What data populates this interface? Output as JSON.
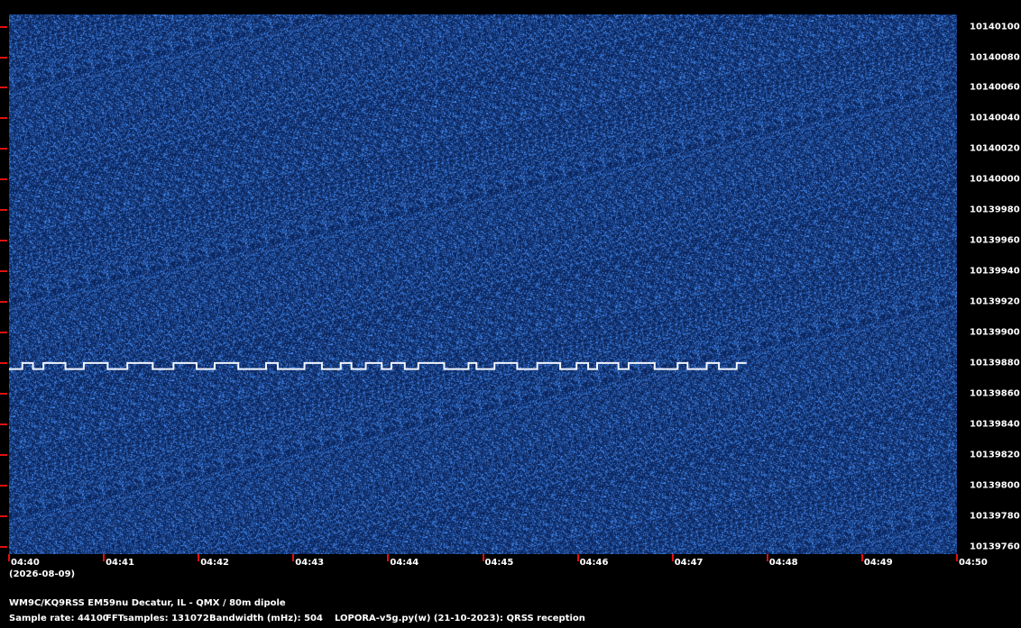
{
  "chart_data": {
    "type": "heatmap",
    "description_kind": "spectrogram",
    "y_unit": "Hz",
    "y_ticks": [
      10140100,
      10140080,
      10140060,
      10140040,
      10140020,
      10140000,
      10139980,
      10139960,
      10139940,
      10139920,
      10139900,
      10139880,
      10139860,
      10139840,
      10139820,
      10139800,
      10139780,
      10139760
    ],
    "y_labels": [
      "10140100",
      "10140080",
      "10140060",
      "10140040",
      "10140020",
      "10140000",
      "10139980",
      "10139960",
      "10139940",
      "10139920",
      "10139900",
      "10139880",
      "10139860",
      "10139840",
      "10139820",
      "10139800",
      "10139780",
      "10139760"
    ],
    "ylim": [
      10139755,
      10140108
    ],
    "x_labels": [
      "04:40",
      "04:41",
      "04:42",
      "04:43",
      "04:44",
      "04:45",
      "04:46",
      "04:47",
      "04:48",
      "04:49",
      "04:50"
    ],
    "x_minutes": [
      0,
      1,
      2,
      3,
      4,
      5,
      6,
      7,
      8,
      9,
      10
    ],
    "xlim": [
      0,
      10
    ],
    "date_label": "(2026-08-09)",
    "signal_trace": {
      "start_minute": 0.0,
      "end_minute": 7.78,
      "base_freq": 10139876,
      "shift_freq": 10139880
    },
    "colors": {
      "background": "#0b2a66",
      "signal": "#f2f6ff",
      "tick": "#e01010"
    }
  },
  "footer": {
    "station": "WM9C/KQ9RSS EM59nu Decatur, IL - QMX / 80m dipole",
    "sample_rate": "Sample rate: 44100",
    "fft_samples": "FFTsamples: 131072",
    "bandwidth": "Bandwidth (mHz): 504",
    "software": "LOPORA-v5g.py(w) (21-10-2023): QRSS reception"
  }
}
